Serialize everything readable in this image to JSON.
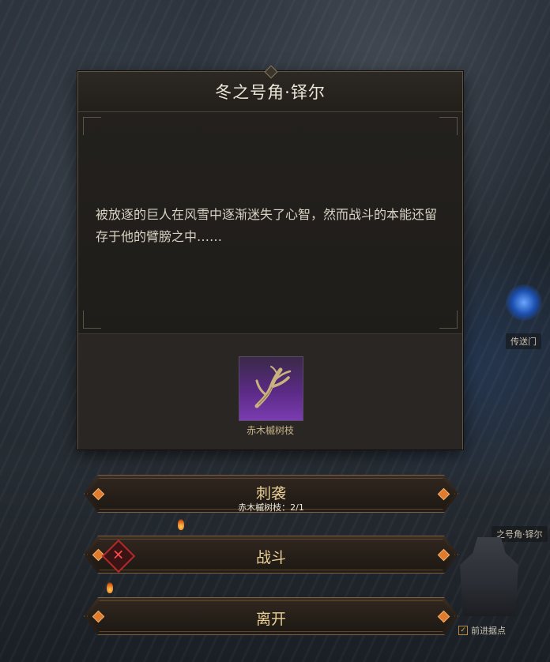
{
  "dialog": {
    "title": "冬之号角·铎尔",
    "story": "被放逐的巨人在风雪中逐渐迷失了心智，然而战斗的本能还留存于他的臂膀之中……",
    "reward_item": {
      "name": "赤木槭树枝",
      "icon": "branch-icon"
    }
  },
  "actions": [
    {
      "label": "刺袭",
      "sub": "赤木槭树枝：2/1"
    },
    {
      "label": "战斗",
      "icon": "crossed-swords-x-icon"
    },
    {
      "label": "离开"
    }
  ],
  "map": {
    "portal_label": "传送门",
    "location_label": "之号角·铎尔",
    "outpost_label": "前进据点"
  },
  "colors": {
    "accent_orange": "#e07a2c",
    "title_text": "#ece6d8",
    "button_text": "#e8cf96",
    "rarity_purple": "#7a3cb0"
  }
}
